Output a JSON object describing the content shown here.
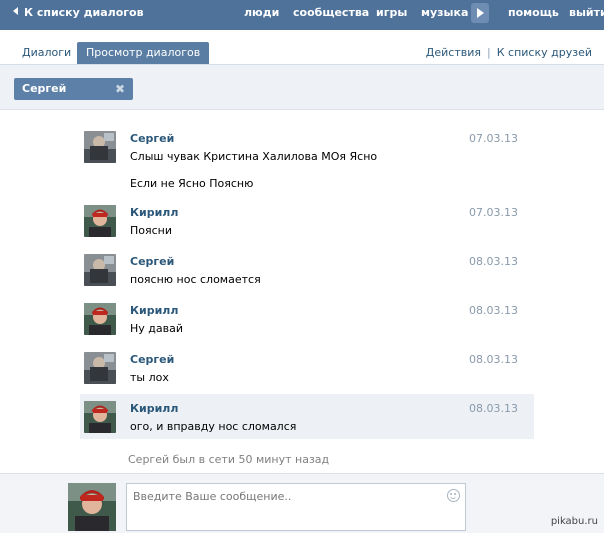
{
  "topbar": {
    "back_label": "К списку диалогов",
    "nav": [
      "люди",
      "сообщества",
      "игры",
      "музыка"
    ],
    "help": "помощь",
    "logout": "выйти"
  },
  "tabs": {
    "items": [
      "Диалоги",
      "Просмотр диалогов"
    ],
    "actions": "Действия",
    "separator": "|",
    "friends_link": "К списку друзей"
  },
  "filter": {
    "chip_label": "Сергей",
    "chip_close": "✖"
  },
  "messages": [
    {
      "author": "Сергей",
      "date": "07.03.13",
      "lines": [
        "Слыш чувак Кристина Халилова МОя Ясно",
        "Если не Ясно Поясню"
      ]
    },
    {
      "author": "Кирилл",
      "date": "07.03.13",
      "lines": [
        "Поясни"
      ]
    },
    {
      "author": "Сергей",
      "date": "08.03.13",
      "lines": [
        "поясню нос сломается"
      ]
    },
    {
      "author": "Кирилл",
      "date": "08.03.13",
      "lines": [
        "Ну давай"
      ]
    },
    {
      "author": "Сергей",
      "date": "08.03.13",
      "lines": [
        "ты лох"
      ]
    },
    {
      "author": "Кирилл",
      "date": "08.03.13",
      "lines": [
        "ого, и вправду нос сломался"
      ]
    }
  ],
  "status": {
    "online_text": "Сергей был в сети 50 минут назад"
  },
  "composer": {
    "placeholder": "Введите Ваше сообщение.."
  },
  "watermark": "pikabu.ru",
  "colors": {
    "topbar": "#4e729a",
    "link": "#2b587a",
    "active_tab": "#597da3",
    "chip": "#5d80a8"
  }
}
